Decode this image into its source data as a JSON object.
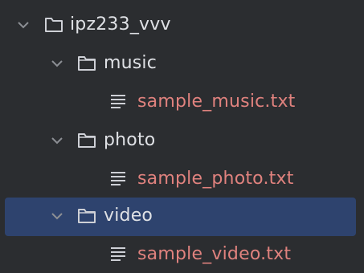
{
  "tree": {
    "root": {
      "label": "ipz233_vvv",
      "expanded": true
    },
    "folders": [
      {
        "label": "music",
        "expanded": true,
        "file": "sample_music.txt"
      },
      {
        "label": "photo",
        "expanded": true,
        "file": "sample_photo.txt"
      },
      {
        "label": "video",
        "expanded": true,
        "selected": true,
        "file": "sample_video.txt"
      }
    ]
  },
  "colors": {
    "background": "#2b2d30",
    "selection": "#2e436e",
    "text": "#dfe1e5",
    "modified_file_text": "#e0827e",
    "icon": "#ced0d6"
  },
  "icons": {
    "expanded": "chevron-down-icon",
    "folder": "folder-icon",
    "text_file": "text-file-icon"
  }
}
